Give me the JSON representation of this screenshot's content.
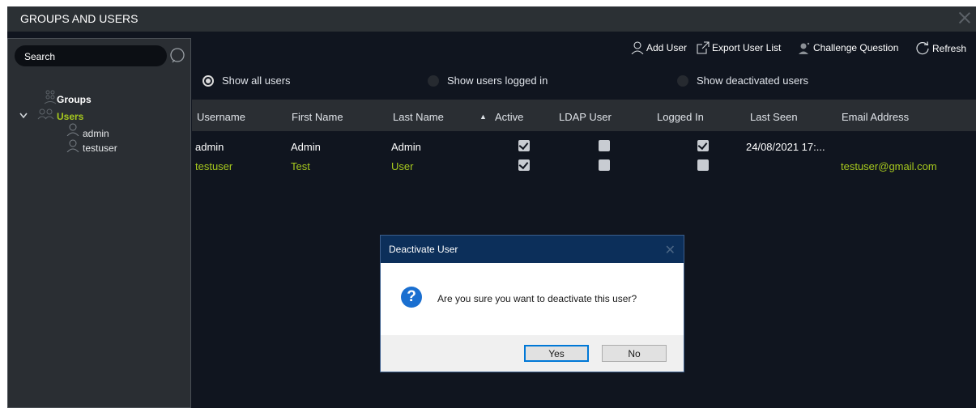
{
  "window": {
    "title": "GROUPS AND USERS"
  },
  "sidebar": {
    "search_placeholder": "Search",
    "tree": {
      "groups_label": "Groups",
      "users_label": "Users",
      "users": [
        "admin",
        "testuser"
      ]
    }
  },
  "toolbar": {
    "add_user": "Add User",
    "export_list": "Export User List",
    "challenge_question": "Challenge Question",
    "refresh": "Refresh"
  },
  "filters": {
    "show_all": "Show all users",
    "show_logged_in": "Show users logged in",
    "show_deactivated": "Show deactivated users",
    "selected": "show_all"
  },
  "table": {
    "columns": {
      "username": "Username",
      "first_name": "First Name",
      "last_name": "Last Name",
      "sort_indicator": "▲",
      "active": "Active",
      "ldap_user": "LDAP User",
      "logged_in": "Logged In",
      "last_seen": "Last Seen",
      "email": "Email Address"
    },
    "rows": [
      {
        "username": "admin",
        "first_name": "Admin",
        "last_name": "Admin",
        "active": true,
        "ldap_user": false,
        "logged_in": true,
        "last_seen": "24/08/2021 17:...",
        "email": "",
        "highlighted": false
      },
      {
        "username": "testuser",
        "first_name": "Test",
        "last_name": "User",
        "active": true,
        "ldap_user": false,
        "logged_in": false,
        "last_seen": "",
        "email": "testuser@gmail.com",
        "highlighted": true
      }
    ]
  },
  "dialog": {
    "title": "Deactivate User",
    "message": "Are you sure you want to deactivate this user?",
    "yes_label": "Yes",
    "no_label": "No"
  },
  "colors": {
    "background": "#10151f",
    "panel": "#2a2e33",
    "highlight_green": "#a6c81e",
    "dialog_title": "#0c2f5a",
    "question_icon": "#1a6fd0"
  }
}
